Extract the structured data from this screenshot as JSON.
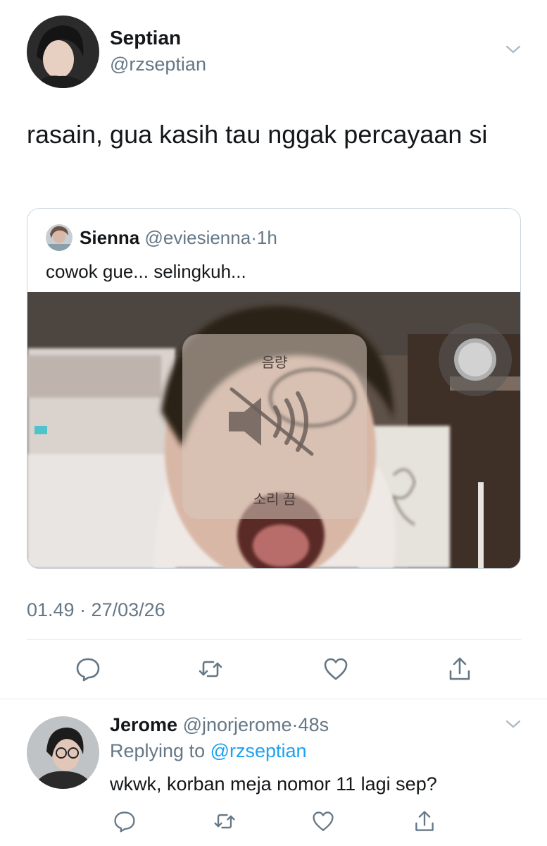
{
  "tweet": {
    "author": {
      "name": "Septian",
      "handle": "@rzseptian"
    },
    "text": "rasain, gua kasih tau nggak percayaan si",
    "timestamp": "01.49 · 27/03/26",
    "quoted": {
      "name": "Sienna",
      "handle": "@eviesienna",
      "separator": "·",
      "age": "1h",
      "text": "cowok gue... selingkuh...",
      "media_overlay": {
        "title": "음량",
        "status": "소리 끔",
        "icon": "speaker-muted-icon"
      }
    },
    "actions": [
      "reply-icon",
      "retweet-icon",
      "like-icon",
      "share-icon"
    ]
  },
  "reply": {
    "author": {
      "name": "Jerome",
      "handle": "@jnorjerome"
    },
    "separator": "·",
    "age": "48s",
    "replying_prefix": "Replying to",
    "replying_to": "@rzseptian",
    "text": "wkwk, korban meja nomor 11 lagi sep?",
    "actions": [
      "reply-icon",
      "retweet-icon",
      "like-icon",
      "share-icon"
    ]
  },
  "colors": {
    "text": "#14171a",
    "muted": "#657786",
    "link": "#1da1f2",
    "divider": "#e1e8ed"
  }
}
